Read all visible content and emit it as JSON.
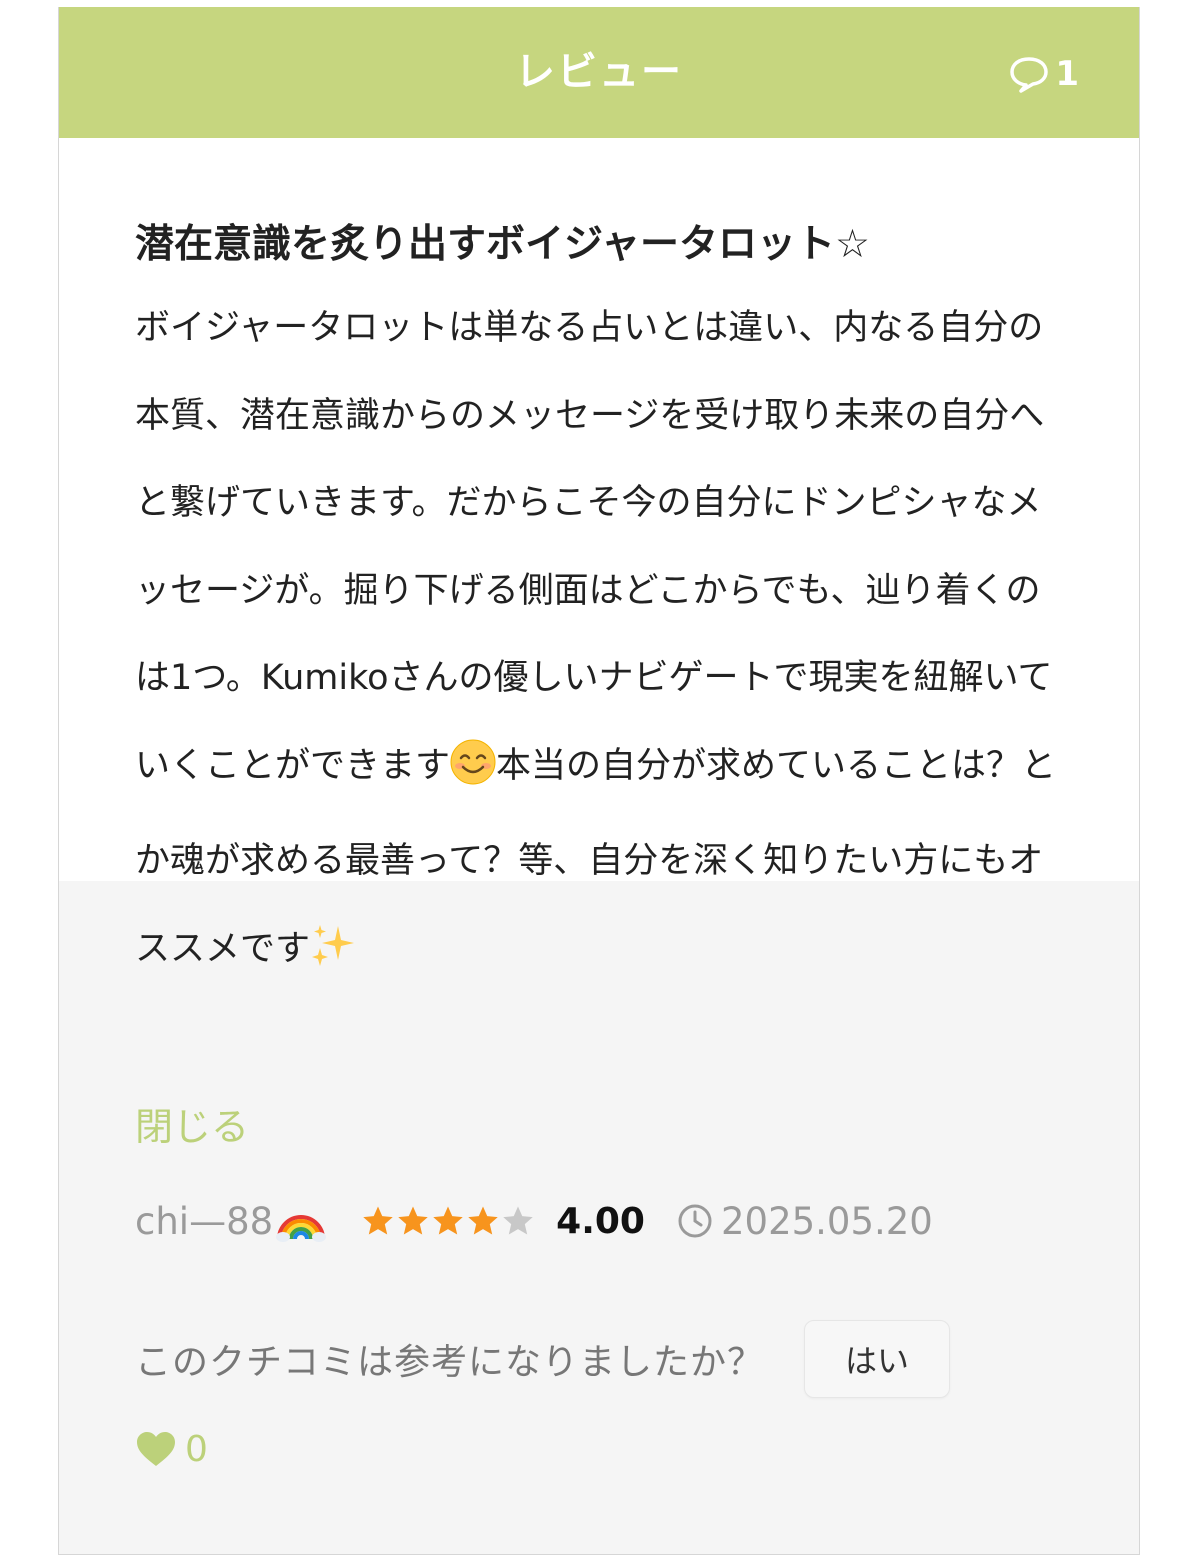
{
  "header": {
    "title": "レビュー",
    "comment_count": "1",
    "background_color": "#c6d67f"
  },
  "review": {
    "title": "潜在意識を炙り出すボイジャータロット☆",
    "body_part1": "ボイジャータロットは単なる占いとは違い、内なる自分の本質、潜在意識からのメッセージを受け取り未来の自分へと繋げていきます。だからこそ今の自分にドンピシャなメッセージが。掘り下げる側面はどこからでも、辿り着くのは1つ。Kumikoさんの優しいナビゲートで現実を紐解いていくことができます",
    "body_part2": "本当の自分が求めていることは？とか魂が求める最善って？等、自分を深く知りたい方にもオススメです",
    "close_label": "閉じる",
    "username": "chi—88",
    "rating": 4.0,
    "rating_text": "4.00",
    "date": "2025.05.20"
  },
  "helpful": {
    "question": "このクチコミは参考になりましたか？",
    "yes_label": "はい",
    "likes": "0"
  },
  "colors": {
    "accent": "#bcd17a",
    "star_filled": "#f7941d",
    "star_empty": "#c8c8c8"
  }
}
